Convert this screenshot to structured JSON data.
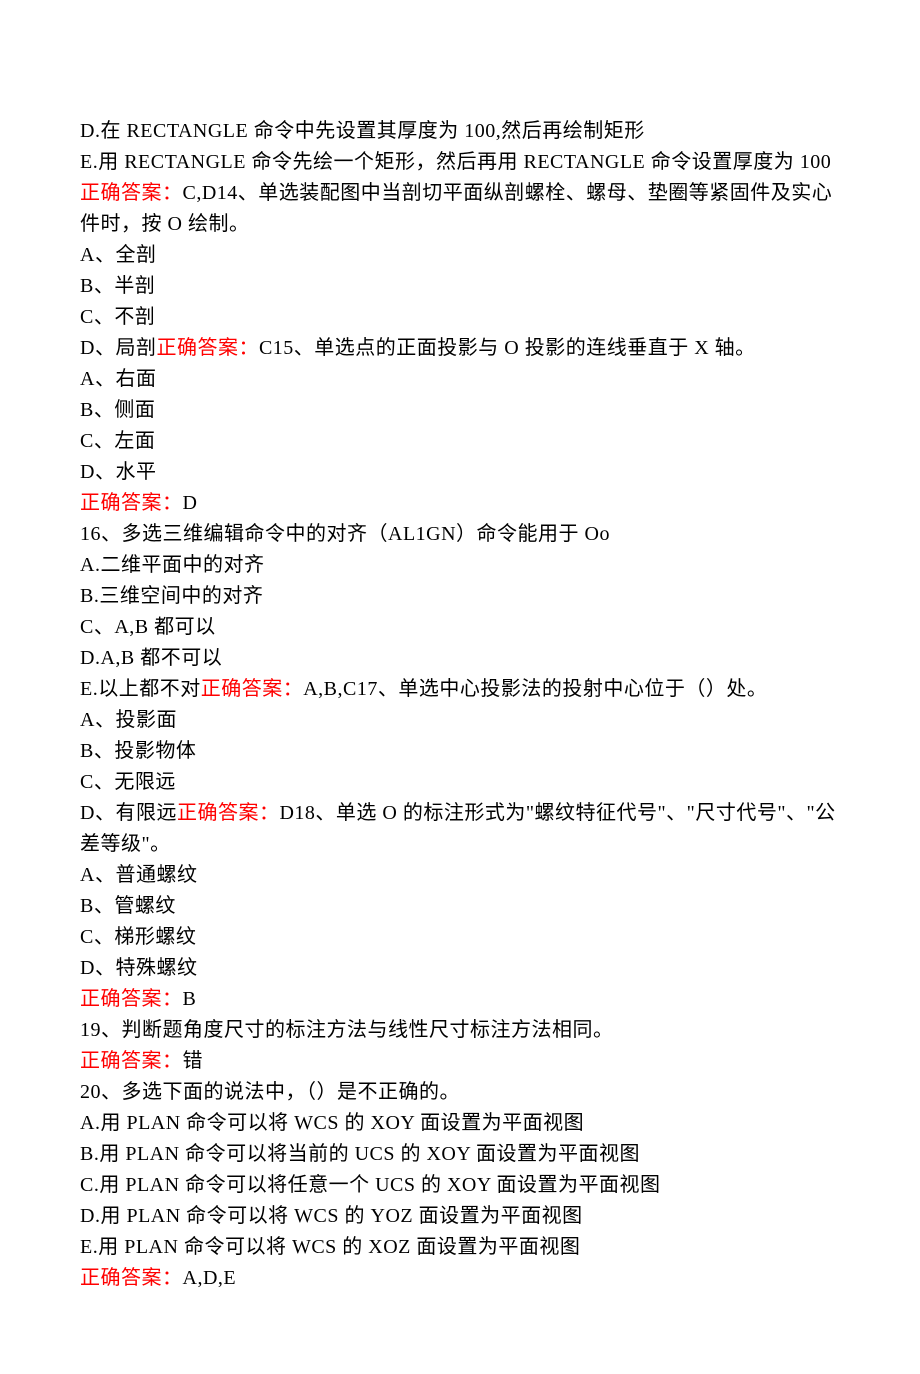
{
  "lines": [
    [
      {
        "t": "D.在 RECTANGLE 命令中先设置其厚度为 100,然后再绘制矩形"
      }
    ],
    [
      {
        "t": "E.用 RECTANGLE 命令先绘一个矩形，然后再用 RECTANGLE 命令设置厚度为 100"
      }
    ],
    [
      {
        "t": "正确答案：",
        "red": true
      },
      {
        "t": "C,D14、单选装配图中当剖切平面纵剖螺栓、螺母、垫圈等紧固件及实心件时，按 O 绘制。"
      }
    ],
    [
      {
        "t": "A、全剖"
      }
    ],
    [
      {
        "t": "B、半剖"
      }
    ],
    [
      {
        "t": "C、不剖"
      }
    ],
    [
      {
        "t": "D、局剖"
      },
      {
        "t": "正确答案：",
        "red": true
      },
      {
        "t": "C15、单选点的正面投影与 O 投影的连线垂直于 X 轴。"
      }
    ],
    [
      {
        "t": "A、右面"
      }
    ],
    [
      {
        "t": "B、侧面"
      }
    ],
    [
      {
        "t": "C、左面"
      }
    ],
    [
      {
        "t": "D、水平"
      }
    ],
    [
      {
        "t": "正确答案：",
        "red": true
      },
      {
        "t": "D"
      }
    ],
    [
      {
        "t": "16、多选三维编辑命令中的对齐（AL1GN）命令能用于 Oo"
      }
    ],
    [
      {
        "t": "A.二维平面中的对齐"
      }
    ],
    [
      {
        "t": "B.三维空间中的对齐"
      }
    ],
    [
      {
        "t": "C、A,B 都可以"
      }
    ],
    [
      {
        "t": "D.A,B 都不可以"
      }
    ],
    [
      {
        "t": "E.以上都不对"
      },
      {
        "t": "正确答案：",
        "red": true
      },
      {
        "t": "A,B,C17、单选中心投影法的投射中心位于（）处。"
      }
    ],
    [
      {
        "t": "A、投影面"
      }
    ],
    [
      {
        "t": "B、投影物体"
      }
    ],
    [
      {
        "t": "C、无限远"
      }
    ],
    [
      {
        "t": "D、有限远"
      },
      {
        "t": "正确答案：",
        "red": true
      },
      {
        "t": "D18、单选 O 的标注形式为\"螺纹特征代号\"、\"尺寸代号\"、\"公差等级\"。"
      }
    ],
    [
      {
        "t": "A、普通螺纹"
      }
    ],
    [
      {
        "t": "B、管螺纹"
      }
    ],
    [
      {
        "t": "C、梯形螺纹"
      }
    ],
    [
      {
        "t": "D、特殊螺纹"
      }
    ],
    [
      {
        "t": "正确答案：",
        "red": true
      },
      {
        "t": "B"
      }
    ],
    [
      {
        "t": "19、判断题角度尺寸的标注方法与线性尺寸标注方法相同。"
      }
    ],
    [
      {
        "t": "正确答案：",
        "red": true
      },
      {
        "t": "错"
      }
    ],
    [
      {
        "t": "20、多选下面的说法中，（）是不正确的。"
      }
    ],
    [
      {
        "t": "A.用 PLAN 命令可以将 WCS 的 XOY 面设置为平面视图"
      }
    ],
    [
      {
        "t": "B.用 PLAN 命令可以将当前的 UCS 的 XOY 面设置为平面视图"
      }
    ],
    [
      {
        "t": "C.用 PLAN 命令可以将任意一个 UCS 的 XOY 面设置为平面视图"
      }
    ],
    [
      {
        "t": "D.用 PLAN 命令可以将 WCS 的 YOZ 面设置为平面视图"
      }
    ],
    [
      {
        "t": "E.用 PLAN 命令可以将 WCS 的 XOZ 面设置为平面视图"
      }
    ],
    [
      {
        "t": "正确答案：",
        "red": true
      },
      {
        "t": "A,D,E"
      }
    ]
  ]
}
